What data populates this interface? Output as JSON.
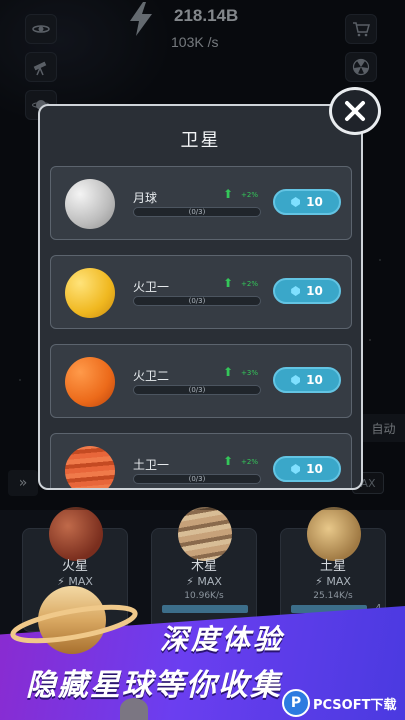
{
  "header": {
    "energy_total": "218.14B",
    "energy_rate": "103K /s"
  },
  "side": {
    "auto_label": "自动",
    "left_strip_icon": "fast-forward-icon",
    "right_strip_label": "AX"
  },
  "modal": {
    "title": "卫星",
    "close_icon": "close-icon",
    "satellites": [
      {
        "name": "月球",
        "bonus": "+2%",
        "progress": "(0/3)",
        "cost": "10",
        "color": "#d8d8d8"
      },
      {
        "name": "火卫一",
        "bonus": "+2%",
        "progress": "(0/3)",
        "cost": "10",
        "color": "#f2c230"
      },
      {
        "name": "火卫二",
        "bonus": "+3%",
        "progress": "(0/3)",
        "cost": "10",
        "color": "#f07020"
      },
      {
        "name": "土卫一",
        "bonus": "+2%",
        "progress": "(0/3)",
        "cost": "10",
        "color": "#e8663a"
      }
    ]
  },
  "planets": [
    {
      "name": "火星",
      "status": "MAX",
      "rate": "",
      "level": ""
    },
    {
      "name": "木星",
      "status": "MAX",
      "rate": "10.96K/s",
      "level": ""
    },
    {
      "name": "土星",
      "status": "MAX",
      "rate": "25.14K/s",
      "level": "4"
    }
  ],
  "promo": {
    "line1": "深度体验",
    "line2": "隐藏星球等你收集",
    "watermark": "PCSOFT下载"
  },
  "colors": {
    "accent": "#3aa7c9",
    "bonus_green": "#34c759",
    "promo_purple": "#6b3ef0"
  }
}
